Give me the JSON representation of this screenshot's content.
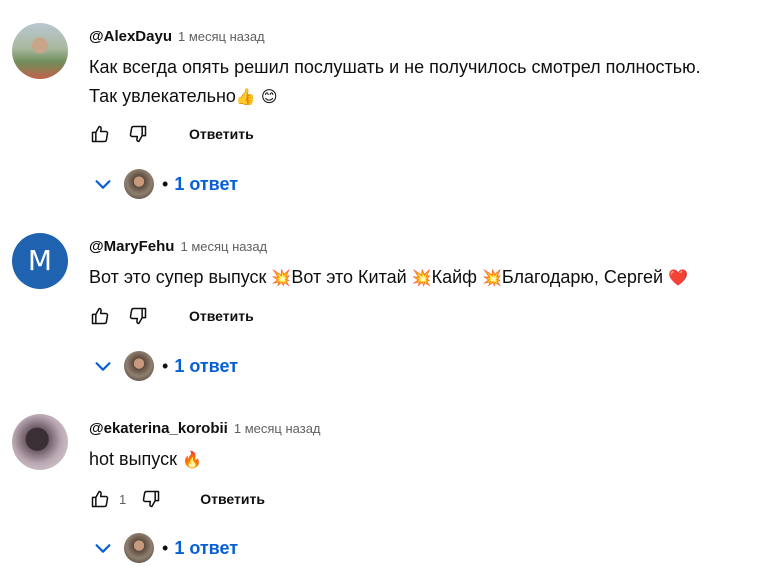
{
  "comments": [
    {
      "author": "@AlexDayu",
      "time": "1 месяц назад",
      "text_lines": [
        "Как всегда опять решил послушать и не получилось смотрел полностью.",
        "Так увлекательно"
      ],
      "emojis": [
        "👍",
        "😊"
      ],
      "like_count": "",
      "reply_label": "Ответить",
      "replies_label": "1 ответ"
    },
    {
      "author": "@MaryFehu",
      "avatar_letter": "M",
      "time": "1 месяц назад",
      "text_segments": [
        "Вот это супер выпуск ",
        "Вот это Китай ",
        "Кайф ",
        "Благодарю, Сергей "
      ],
      "emojis": [
        "💥",
        "💥",
        "💥",
        "❤️"
      ],
      "like_count": "",
      "reply_label": "Ответить",
      "replies_label": "1 ответ"
    },
    {
      "author": "@ekaterina_korobii",
      "time": "1 месяц назад",
      "text_segments": [
        "hot выпуск "
      ],
      "emojis": [
        "🔥"
      ],
      "like_count": "1",
      "reply_label": "Ответить",
      "replies_label": "1 ответ"
    }
  ],
  "icons": {
    "like": "thumbs-up-outline-icon",
    "dislike": "thumbs-down-outline-icon",
    "expand": "chevron-down-icon"
  },
  "colors": {
    "link_blue": "#065fd4",
    "avatar_blue": "#1f62b0",
    "text_primary": "#0f0f0f",
    "text_secondary": "#606060"
  }
}
